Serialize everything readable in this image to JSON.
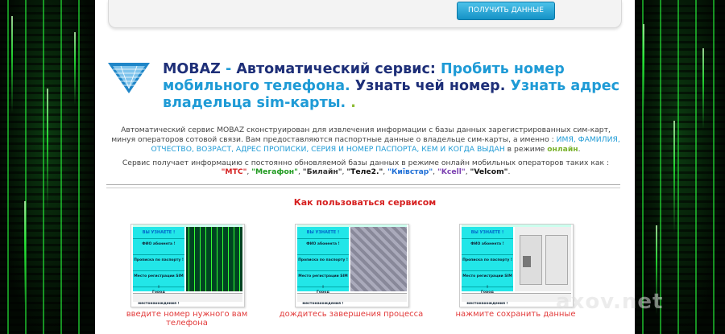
{
  "form": {
    "button_label": "ПОЛУЧИТЬ ДАННЫЕ"
  },
  "headline": {
    "part1": "MOBAZ",
    "dash": " - ",
    "part2": "Автоматический сервис: ",
    "part3": "Пробить номер мобильного телефона.",
    "part4": " Узнать чей номер. ",
    "part5": "Узнать адрес владельца sim-карты.",
    "part6": " ."
  },
  "description": {
    "text": "Автоматический сервис MOBAZ сконструирован для извлечения информации с базы данных зарегистрированных сим-карт, минуя операторов сотовой связи. Вам предоставляются паспортные данные о владельце сим-карты, а именно : ",
    "highlights": "ИМЯ, ФАМИЛИЯ, ОТЧЕСТВО, ВОЗРАСТ, АДРЕС ПРОПИСКИ, СЕРИЯ И НОМЕР ПАСПОРТА, КЕМ И КОГДА ВЫДАН",
    "mode_prefix": " в режиме ",
    "mode_online": "онлайн",
    "mode_suffix": "."
  },
  "operators": {
    "intro": "Сервис получает информацию с постоянно обновляемой базы данных в режиме онлайн мобильных операторов таких как :",
    "list": [
      {
        "name": "\"МТС\"",
        "color": "#d42020"
      },
      {
        "name": "\"Мегафон\"",
        "color": "#1f9a1f"
      },
      {
        "name": "\"Билайн\"",
        "color": "#333333"
      },
      {
        "name": "\"Теле2.\"",
        "color": "#111111"
      },
      {
        "name": "\"Київстар\"",
        "color": "#1f6fd6"
      },
      {
        "name": "\"Kcell\"",
        "color": "#7a3fb0"
      },
      {
        "name": "\"Velcom\"",
        "color": "#111111"
      }
    ],
    "separator": ", ",
    "end": "."
  },
  "howto": {
    "title": "Как пользоваться сервисом"
  },
  "steps": [
    {
      "caption": "введите номер нужного вам телефона",
      "panel": "matrix"
    },
    {
      "caption": "дождитесь завершения процесса",
      "panel": "map"
    },
    {
      "caption": "нажмите сохранить данные",
      "panel": "docs"
    }
  ],
  "step_menu": {
    "head": "ВЫ УЗНАЕТЕ !",
    "rows": [
      "ФИО абонента !",
      "Прописка по паспорту !",
      "Место регистрации SIM !",
      "Город местонахождения !"
    ]
  },
  "watermark": {
    "text": "axov.net"
  },
  "colors": {
    "accent_blue": "#1f9bd6",
    "navy": "#1e2f78",
    "red": "#d62020",
    "green": "#7bb32e"
  }
}
